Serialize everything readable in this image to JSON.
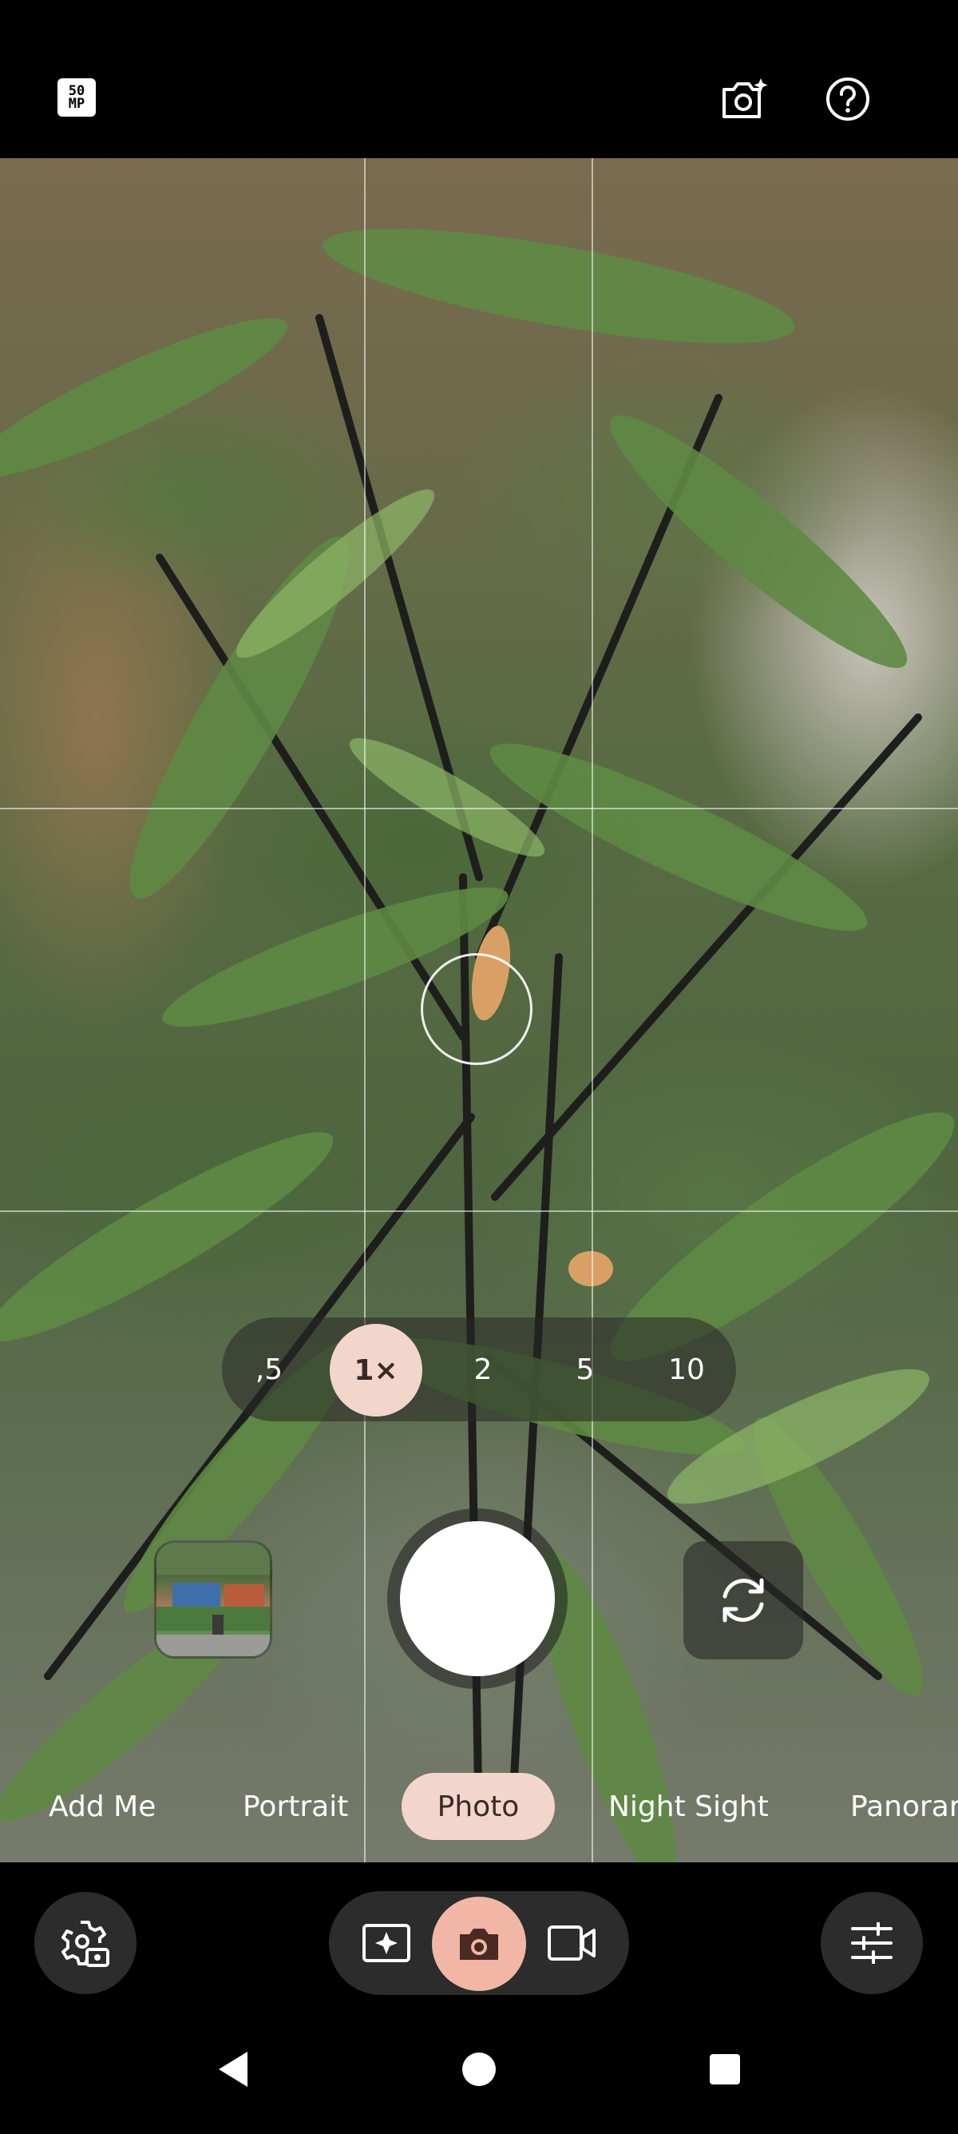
{
  "top_bar": {
    "megapixel_badge": {
      "line1": "50",
      "line2": "MP",
      "icon": "50mp-icon"
    },
    "camera_sparkle_icon": "camera-sparkle-icon",
    "help_icon": "help-icon"
  },
  "viewfinder": {
    "grid": true,
    "zoom_options": [
      {
        "label": ",5",
        "selected": false
      },
      {
        "label": "1×",
        "selected": true
      },
      {
        "label": "2",
        "selected": false
      },
      {
        "label": "5",
        "selected": false
      },
      {
        "label": "10",
        "selected": false
      }
    ],
    "flip_icon": "switch-camera-icon"
  },
  "modes": {
    "items": [
      "Add Me",
      "Portrait",
      "Photo",
      "Night Sight",
      "Panorar"
    ],
    "selected": "Photo"
  },
  "bottom_bar": {
    "settings_icon": "camera-settings-icon",
    "capture_types": [
      {
        "icon": "sparkle-frame-icon",
        "selected": false
      },
      {
        "icon": "camera-icon",
        "selected": true
      },
      {
        "icon": "video-icon",
        "selected": false
      }
    ],
    "adjust_icon": "sliders-icon"
  },
  "system_nav": {
    "back": "back-icon",
    "home": "home-icon",
    "recents": "recents-icon"
  },
  "colors": {
    "accent": "#f2d6cc",
    "accent_strong": "#f2b6a6",
    "panel": "#2c2c2c"
  }
}
